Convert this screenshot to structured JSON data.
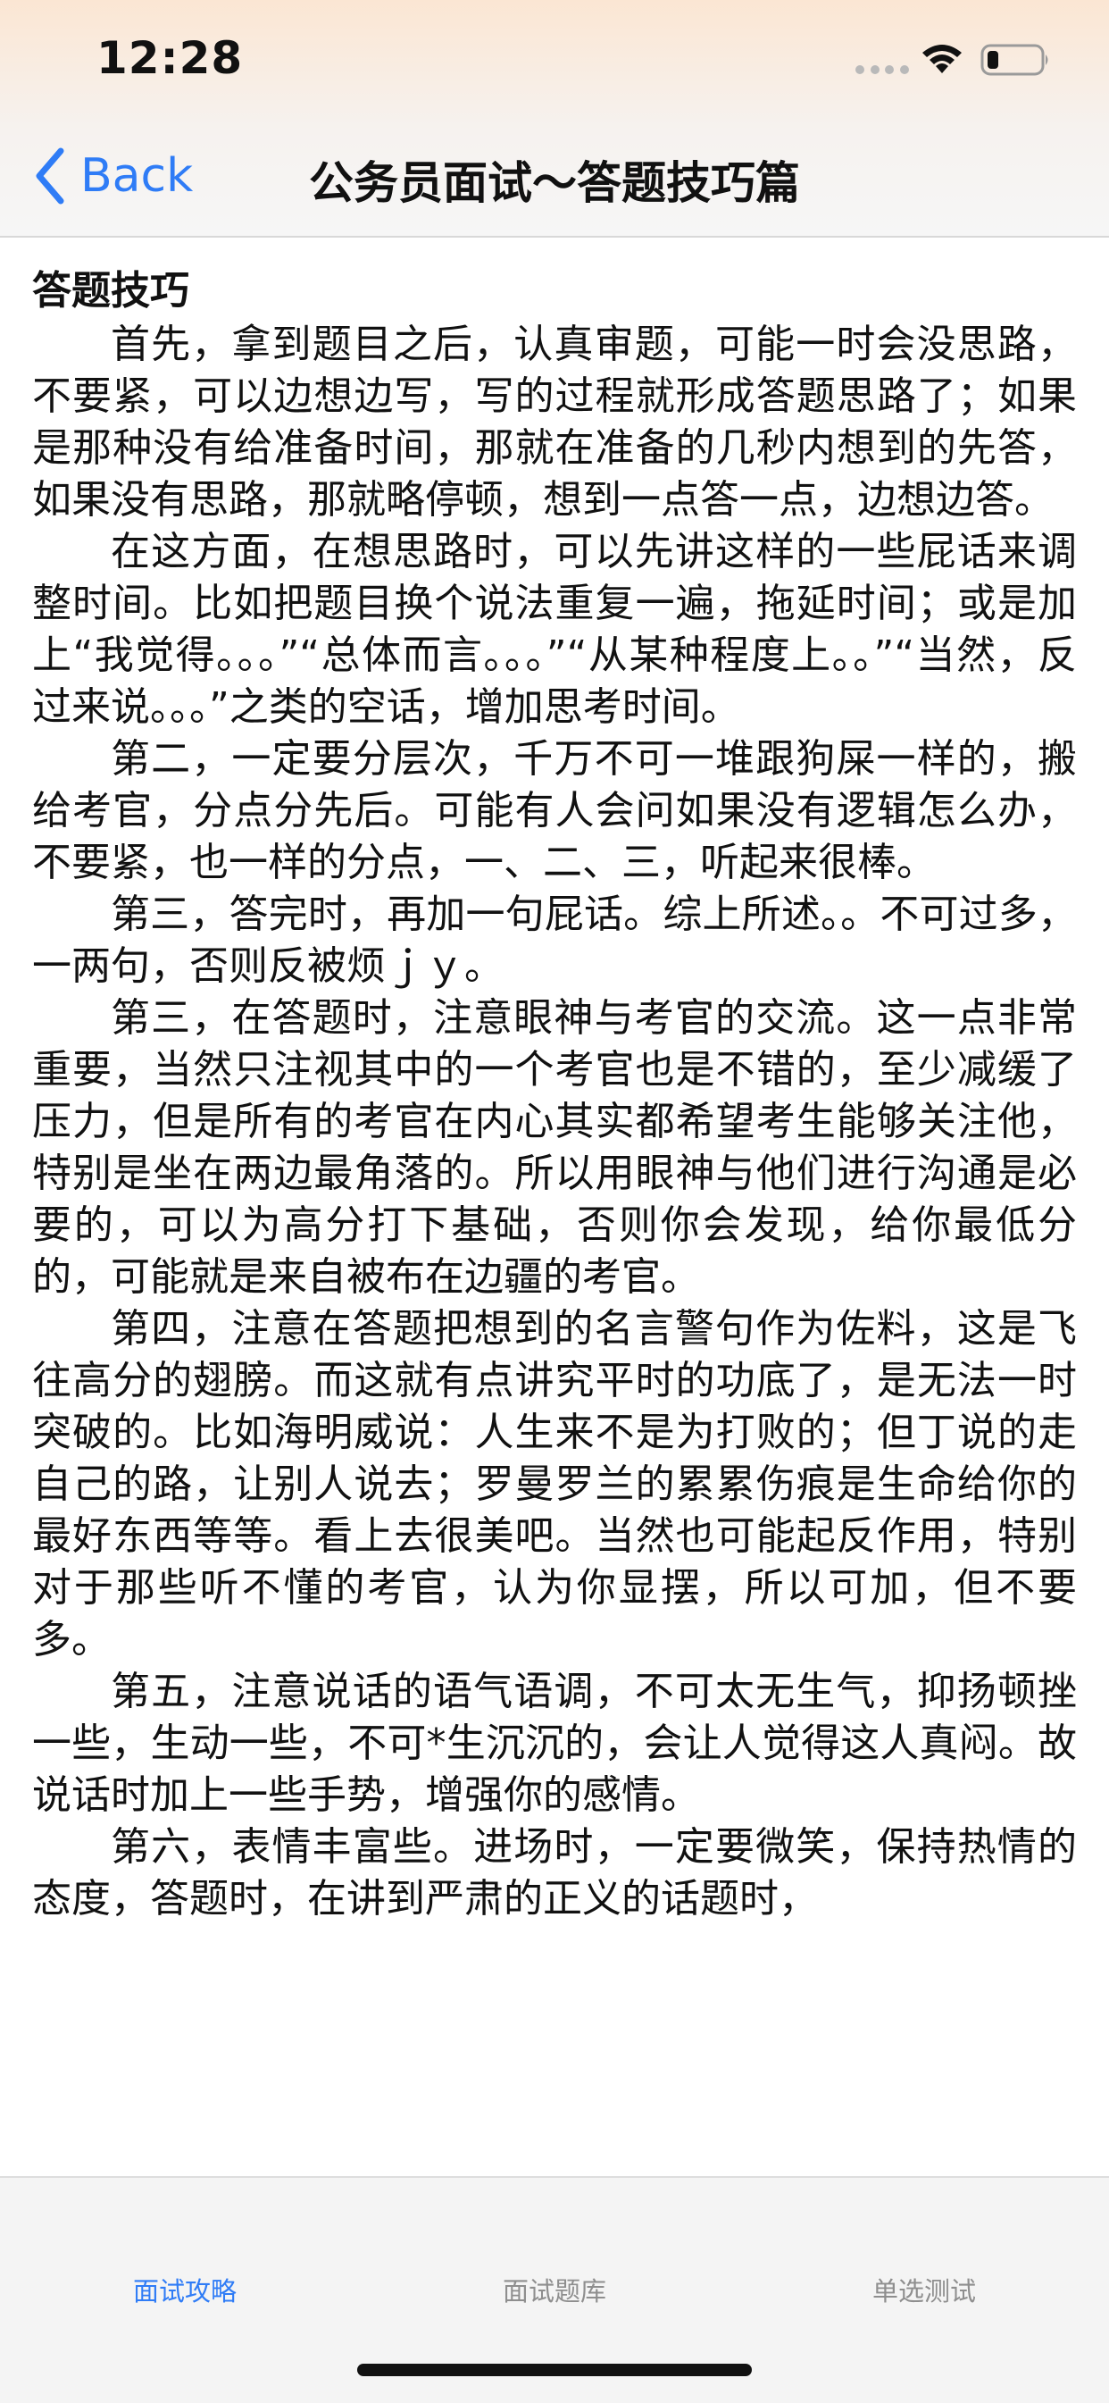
{
  "status_bar": {
    "time": "12:28"
  },
  "nav": {
    "back_label": "Back",
    "title": "公务员面试～答题技巧篇"
  },
  "article": {
    "heading": "答题技巧",
    "paragraphs": [
      "首先，拿到题目之后，认真审题，可能一时会没思路，不要紧，可以边想边写，写的过程就形成答题思路了；如果是那种没有给准备时间，那就在准备的几秒内想到的先答，如果没有思路，那就略停顿，想到一点答一点，边想边答。",
      "在这方面，在想思路时，可以先讲这样的一些屁话来调整时间。比如把题目换个说法重复一遍，拖延时间；或是加上“我觉得。。。”“总体而言。。。”“从某种程度上。。”“当然，反过来说。。。”之类的空话，增加思考时间。",
      "第二，一定要分层次，千万不可一堆跟狗屎一样的，搬给考官，分点分先后。可能有人会问如果没有逻辑怎么办，不要紧，也一样的分点，一、二、三，听起来很棒。",
      "第三，答完时，再加一句屁话。综上所述。。不可过多，一两句，否则反被烦ｊｙ。",
      "第三，在答题时，注意眼神与考官的交流。这一点非常重要，当然只注视其中的一个考官也是不错的，至少减缓了压力，但是所有的考官在内心其实都希望考生能够关注他，特别是坐在两边最角落的。所以用眼神与他们进行沟通是必要的，可以为高分打下基础，否则你会发现，给你最低分的，可能就是来自被布在边疆的考官。",
      "第四，注意在答题把想到的名言警句作为佐料，这是飞往高分的翅膀。而这就有点讲究平时的功底了，是无法一时突破的。比如海明威说：人生来不是为打败的；但丁说的走自己的路，让别人说去；罗曼罗兰的累累伤痕是生命给你的最好东西等等。看上去很美吧。当然也可能起反作用，特别对于那些听不懂的考官，认为你显摆，所以可加，但不要多。",
      "第五，注意说话的语气语调，不可太无生气，抑扬顿挫一些，生动一些，不可*生沉沉的，会让人觉得这人真闷。故说话时加上一些手势，增强你的感情。",
      "第六，表情丰富些。进场时，一定要微笑，保持热情的态度，答题时，在讲到严肃的正义的话题时，"
    ]
  },
  "tab_bar": {
    "tabs": [
      {
        "label": "面试攻略",
        "selected": true
      },
      {
        "label": "面试题库",
        "selected": false
      },
      {
        "label": "单选测试",
        "selected": false
      }
    ]
  },
  "colors": {
    "accent": "#2f7cf6",
    "inactive_tab": "#8e8e8e"
  }
}
